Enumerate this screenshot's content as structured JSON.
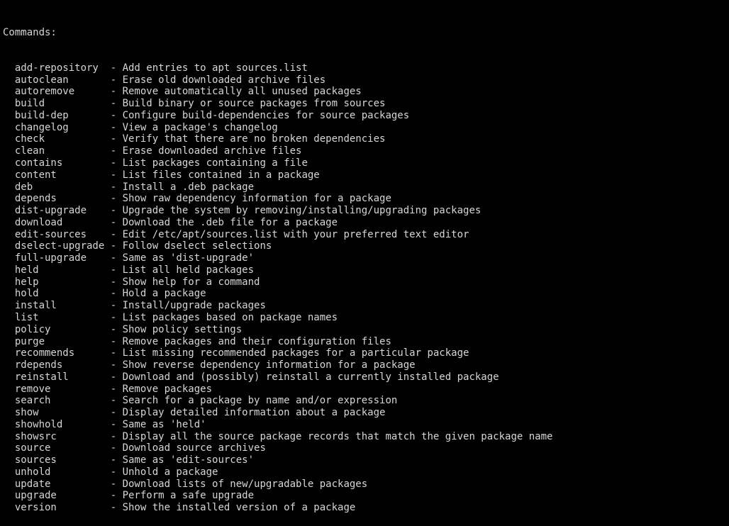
{
  "terminal": {
    "heading": "Commands:",
    "indent": 2,
    "name_column_width": 16,
    "separator": "-",
    "background_color": "#000000",
    "foreground_color": "#d6d6d6",
    "commands": [
      {
        "name": "add-repository",
        "description": "Add entries to apt sources.list"
      },
      {
        "name": "autoclean",
        "description": "Erase old downloaded archive files"
      },
      {
        "name": "autoremove",
        "description": "Remove automatically all unused packages"
      },
      {
        "name": "build",
        "description": "Build binary or source packages from sources"
      },
      {
        "name": "build-dep",
        "description": "Configure build-dependencies for source packages"
      },
      {
        "name": "changelog",
        "description": "View a package's changelog"
      },
      {
        "name": "check",
        "description": "Verify that there are no broken dependencies"
      },
      {
        "name": "clean",
        "description": "Erase downloaded archive files"
      },
      {
        "name": "contains",
        "description": "List packages containing a file"
      },
      {
        "name": "content",
        "description": "List files contained in a package"
      },
      {
        "name": "deb",
        "description": "Install a .deb package"
      },
      {
        "name": "depends",
        "description": "Show raw dependency information for a package"
      },
      {
        "name": "dist-upgrade",
        "description": "Upgrade the system by removing/installing/upgrading packages"
      },
      {
        "name": "download",
        "description": "Download the .deb file for a package"
      },
      {
        "name": "edit-sources",
        "description": "Edit /etc/apt/sources.list with your preferred text editor"
      },
      {
        "name": "dselect-upgrade",
        "description": "Follow dselect selections"
      },
      {
        "name": "full-upgrade",
        "description": "Same as 'dist-upgrade'"
      },
      {
        "name": "held",
        "description": "List all held packages"
      },
      {
        "name": "help",
        "description": "Show help for a command"
      },
      {
        "name": "hold",
        "description": "Hold a package"
      },
      {
        "name": "install",
        "description": "Install/upgrade packages"
      },
      {
        "name": "list",
        "description": "List packages based on package names"
      },
      {
        "name": "policy",
        "description": "Show policy settings"
      },
      {
        "name": "purge",
        "description": "Remove packages and their configuration files"
      },
      {
        "name": "recommends",
        "description": "List missing recommended packages for a particular package"
      },
      {
        "name": "rdepends",
        "description": "Show reverse dependency information for a package"
      },
      {
        "name": "reinstall",
        "description": "Download and (possibly) reinstall a currently installed package"
      },
      {
        "name": "remove",
        "description": "Remove packages"
      },
      {
        "name": "search",
        "description": "Search for a package by name and/or expression"
      },
      {
        "name": "show",
        "description": "Display detailed information about a package"
      },
      {
        "name": "showhold",
        "description": "Same as 'held'"
      },
      {
        "name": "showsrc",
        "description": "Display all the source package records that match the given package name"
      },
      {
        "name": "source",
        "description": "Download source archives"
      },
      {
        "name": "sources",
        "description": "Same as 'edit-sources'"
      },
      {
        "name": "unhold",
        "description": "Unhold a package"
      },
      {
        "name": "update",
        "description": "Download lists of new/upgradable packages"
      },
      {
        "name": "upgrade",
        "description": "Perform a safe upgrade"
      },
      {
        "name": "version",
        "description": "Show the installed version of a package"
      }
    ]
  }
}
